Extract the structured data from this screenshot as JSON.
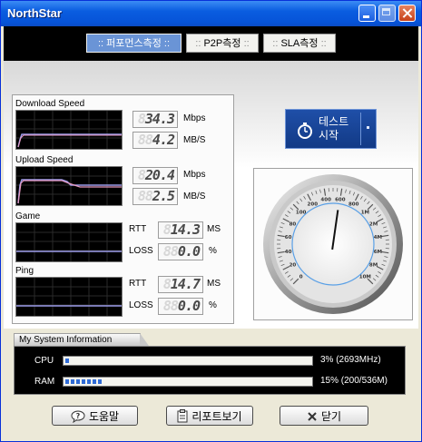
{
  "window": {
    "title": "NorthStar"
  },
  "tabs": [
    {
      "label": "퍼포먼스측정",
      "active": true
    },
    {
      "label": "P2P측정",
      "active": false
    },
    {
      "label": "SLA측정",
      "active": false
    }
  ],
  "tab_decor": ":: ",
  "tab_decor_end": " ::",
  "download": {
    "label": "Download Speed",
    "mbps": {
      "value": "34.3",
      "ghost": "8",
      "unit": "Mbps"
    },
    "mbs": {
      "value": "4.2",
      "ghost": "88",
      "unit": "MB/S"
    }
  },
  "upload": {
    "label": "Upload Speed",
    "mbps": {
      "value": "20.4",
      "ghost": "8",
      "unit": "Mbps"
    },
    "mbs": {
      "value": "2.5",
      "ghost": "88",
      "unit": "MB/S"
    }
  },
  "game": {
    "label": "Game",
    "rtt": {
      "name": "RTT",
      "value": "14.3",
      "ghost": "8",
      "unit": "MS"
    },
    "loss": {
      "name": "LOSS",
      "value": "0.0",
      "ghost": "88",
      "unit": "%"
    }
  },
  "ping": {
    "label": "Ping",
    "rtt": {
      "name": "RTT",
      "value": "14.7",
      "ghost": "8",
      "unit": "MS"
    },
    "loss": {
      "name": "LOSS",
      "value": "0.0",
      "ghost": "88",
      "unit": "%"
    }
  },
  "start_button": {
    "line1": "테스트",
    "line2": "시작"
  },
  "gauge": {
    "ticks": [
      "0",
      "20",
      "40",
      "60",
      "80",
      "100",
      "200",
      "400",
      "600",
      "800",
      "1M",
      "2M",
      "4M",
      "6M",
      "8M",
      "10M"
    ],
    "needle_fraction": 0.53
  },
  "system_info": {
    "title": "My System Information",
    "cpu": {
      "label": "CPU",
      "percent": 3,
      "text": "3% (2693MHz)"
    },
    "ram": {
      "label": "RAM",
      "percent": 15,
      "text": "15% (200/536M)"
    }
  },
  "buttons": {
    "help": "도움말",
    "report": "리포트보기",
    "close": "닫기"
  },
  "colors": {
    "accent": "#0a5de0",
    "active_tab": "#6a94d6",
    "start_button": "#1f4fa8",
    "bar_fill": "#2f6bd6"
  }
}
